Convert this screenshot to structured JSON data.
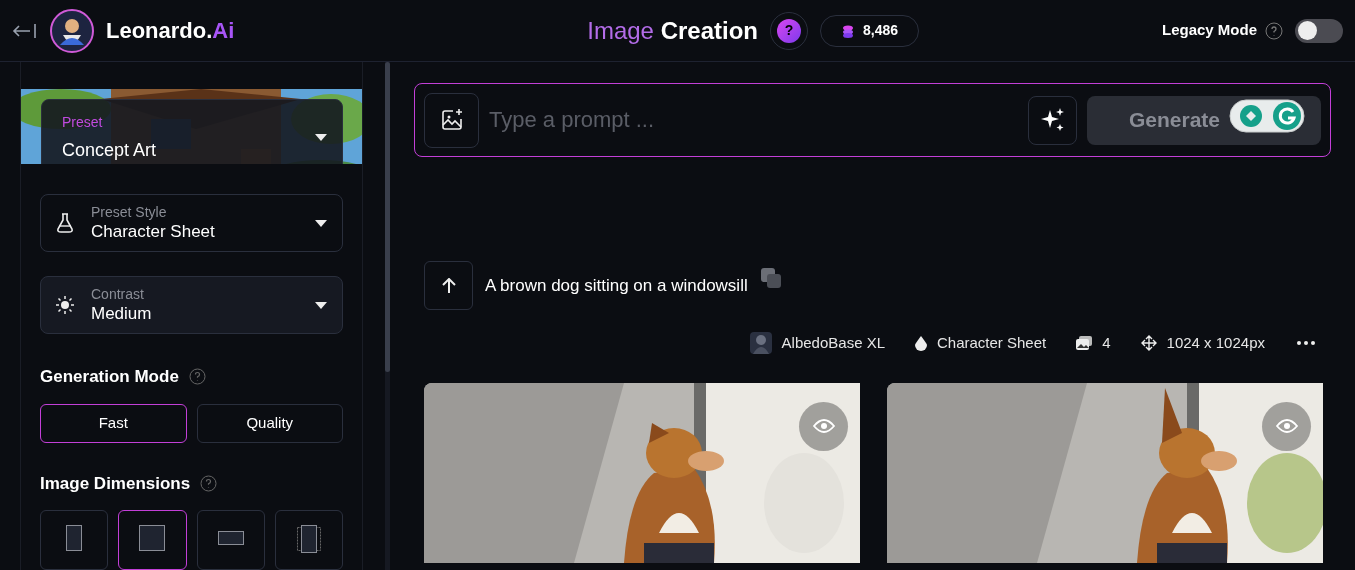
{
  "header": {
    "brand": "Leonardo.",
    "brand_accent": "Ai",
    "title_accent": "Image",
    "title": "Creation",
    "help": "?",
    "credits": "8,486",
    "legacy_label": "Legacy Mode",
    "legacy_on": false
  },
  "sidebar": {
    "preset": {
      "label": "Preset",
      "value": "Concept Art"
    },
    "dropdowns": [
      {
        "kind": "flask",
        "label": "Preset Style",
        "value": "Character Sheet"
      },
      {
        "kind": "sun",
        "label": "Contrast",
        "value": "Medium"
      }
    ],
    "generation_mode": {
      "title": "Generation Mode",
      "options": [
        {
          "label": "Fast",
          "selected": true
        },
        {
          "label": "Quality",
          "selected": false
        }
      ]
    },
    "image_dimensions": {
      "title": "Image Dimensions",
      "options": [
        {
          "kind": "portrait",
          "selected": false
        },
        {
          "kind": "square",
          "selected": true
        },
        {
          "kind": "landscape",
          "selected": false
        },
        {
          "kind": "stack",
          "selected": false
        }
      ]
    }
  },
  "prompt": {
    "placeholder": "Type a prompt ...",
    "generate": "Generate"
  },
  "generation": {
    "prompt": "A brown dog sitting on a windowsill",
    "model": "AlbedoBase XL",
    "style": "Character Sheet",
    "count": "4",
    "size": "1024 x 1024px"
  }
}
